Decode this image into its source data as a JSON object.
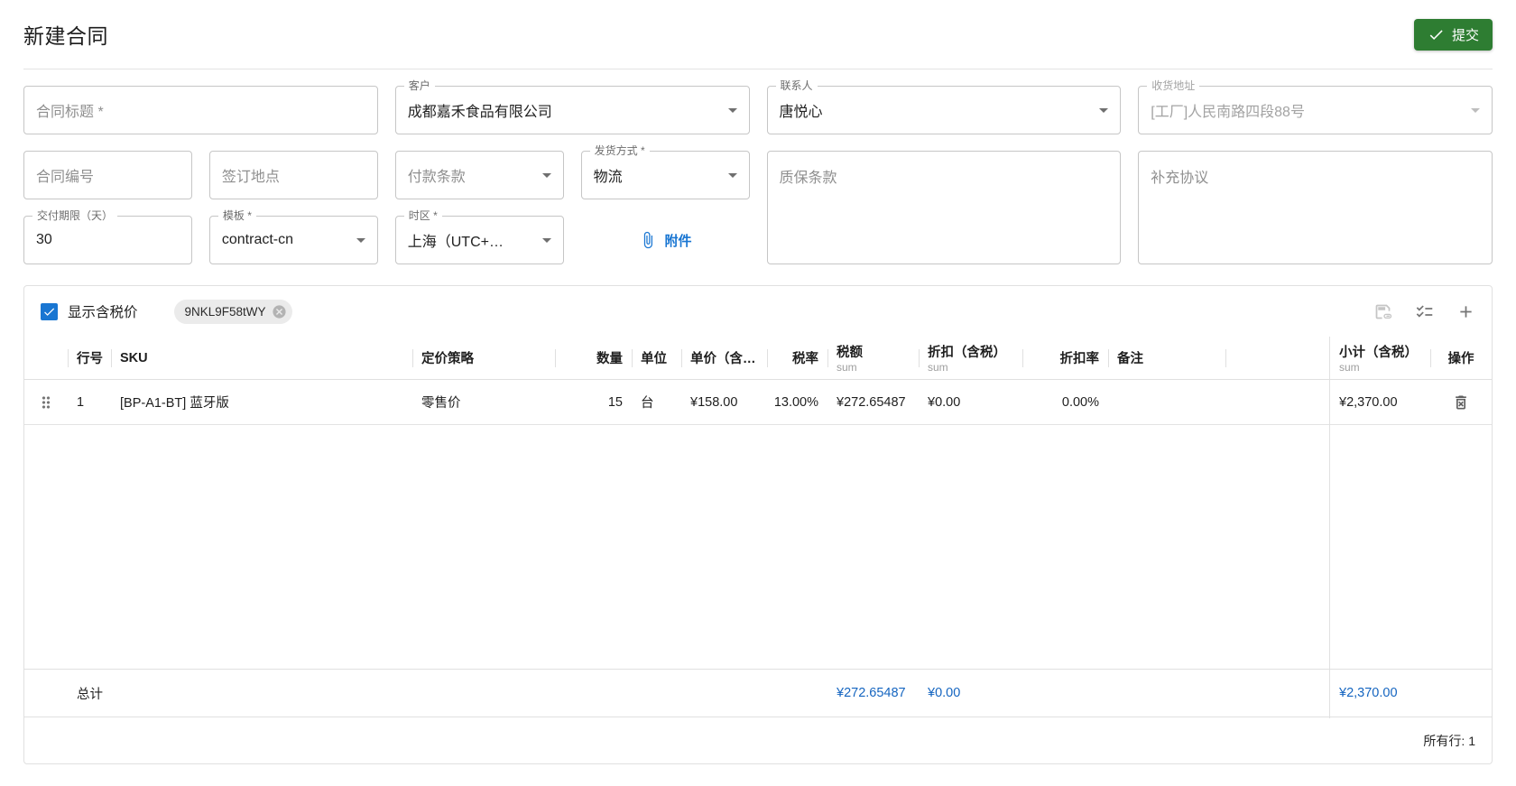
{
  "page": {
    "title": "新建合同"
  },
  "header": {
    "submit_label": "提交"
  },
  "colors": {
    "accent_green": "#2e7d32",
    "accent_blue": "#1976d2",
    "total_blue": "#1565c0"
  },
  "form": {
    "contract_title": {
      "placeholder": "合同标题 *"
    },
    "customer": {
      "label": "客户",
      "value": "成都嘉禾食品有限公司"
    },
    "contact": {
      "label": "联系人",
      "value": "唐悦心"
    },
    "shipping_address": {
      "label": "收货地址",
      "value": "[工厂]人民南路四段88号"
    },
    "contract_no": {
      "placeholder": "合同编号"
    },
    "signing_place": {
      "placeholder": "签订地点"
    },
    "payment_terms": {
      "placeholder": "付款条款"
    },
    "shipping_method": {
      "label": "发货方式 *",
      "value": "物流"
    },
    "warranty": {
      "placeholder": "质保条款"
    },
    "supplement": {
      "placeholder": "补充协议"
    },
    "delivery_days": {
      "label": "交付期限（天）",
      "value": "30"
    },
    "template": {
      "label": "模板 *",
      "value": "contract-cn"
    },
    "timezone": {
      "label": "时区 *",
      "value": "上海（UTC+…"
    },
    "attachment_label": "附件"
  },
  "grid": {
    "show_tax_label": "显示含税价",
    "tag": "9NKL9F58tWY",
    "columns": [
      {
        "label": ""
      },
      {
        "label": "行号"
      },
      {
        "label": "SKU"
      },
      {
        "label": "定价策略"
      },
      {
        "label": "数量"
      },
      {
        "label": "单位"
      },
      {
        "label": "单价（含…"
      },
      {
        "label": "税率"
      },
      {
        "label": "税额",
        "sub": "sum"
      },
      {
        "label": "折扣（含税）",
        "sub": "sum"
      },
      {
        "label": "折扣率"
      },
      {
        "label": "备注"
      },
      {
        "label": ""
      },
      {
        "label": "小计（含税）",
        "sub": "sum"
      },
      {
        "label": "操作"
      }
    ],
    "rows": [
      {
        "line_no": "1",
        "sku": "[BP-A1-BT] 蓝牙版",
        "pricing": "零售价",
        "qty": "15",
        "unit": "台",
        "unit_price": "¥158.00",
        "tax_rate": "13.00%",
        "tax_amount": "¥272.65487",
        "discount": "¥0.00",
        "discount_rate": "0.00%",
        "note": "",
        "subtotal": "¥2,370.00"
      }
    ],
    "footer": {
      "total_label": "总计",
      "tax_sum": "¥272.65487",
      "discount_sum": "¥0.00",
      "subtotal_sum": "¥2,370.00",
      "all_rows": "所有行: 1"
    }
  }
}
